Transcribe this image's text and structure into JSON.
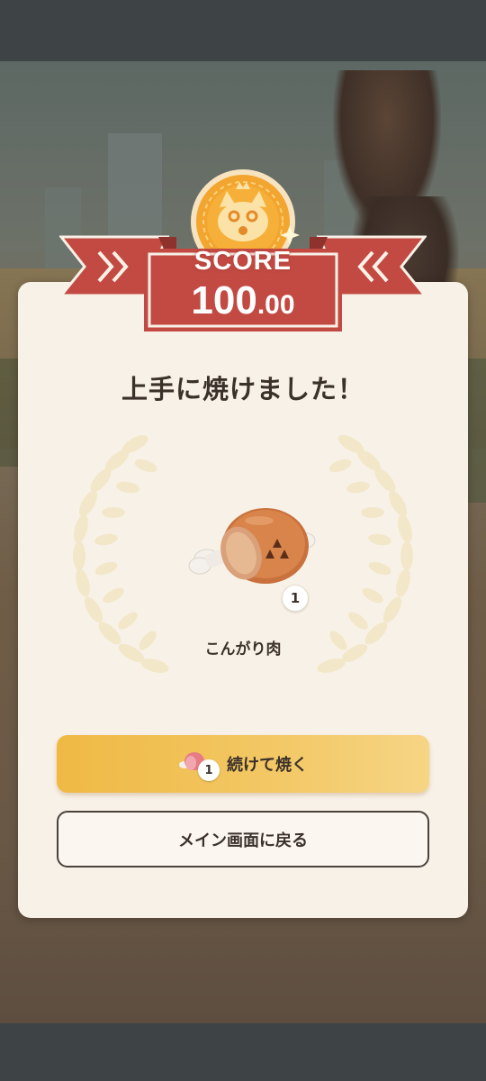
{
  "score": {
    "label": "SCORE",
    "value_integer": "100",
    "value_decimal": ".00"
  },
  "result": {
    "title": "上手に焼けました！",
    "item": {
      "name": "こんがり肉",
      "quantity": "1",
      "icon": "well-done-steak-icon"
    }
  },
  "buttons": {
    "continue_label": "続けて焼く",
    "continue_cost_quantity": "1",
    "continue_cost_icon": "raw-meat-icon",
    "back_label": "メイン画面に戻る"
  },
  "colors": {
    "banner_red": "#c24a43",
    "card_bg": "#f8f1e7",
    "continue_button": "#efb944",
    "medal_gold": "#f2a52f"
  }
}
